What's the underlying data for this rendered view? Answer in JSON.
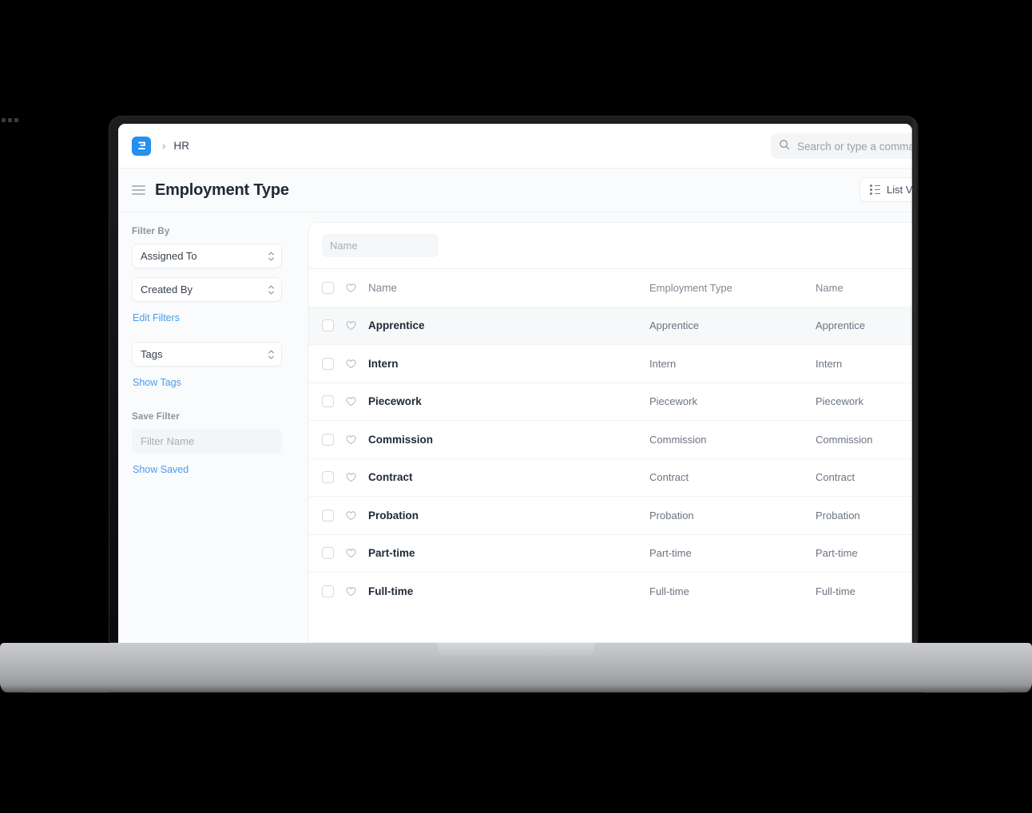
{
  "navbar": {
    "logo_icon": "erpnext-logo-icon",
    "breadcrumb_separator": "›",
    "breadcrumb": "HR",
    "search_icon": "search-icon",
    "search_placeholder": "Search or type a comma",
    "search_value": ""
  },
  "pagehead": {
    "menu_icon": "hamburger-menu-icon",
    "title": "Employment Type",
    "view_switcher_icon": "list-view-icon",
    "view_switcher_label": "List Vie"
  },
  "sidebar": {
    "filter_by_label": "Filter By",
    "filters": [
      {
        "label": "Assigned To",
        "icon": "stepper-chevrons-icon"
      },
      {
        "label": "Created By",
        "icon": "stepper-chevrons-icon"
      }
    ],
    "edit_filters_link": "Edit Filters",
    "tags": {
      "label": "Tags",
      "icon": "stepper-chevrons-icon"
    },
    "show_tags_link": "Show Tags",
    "save_filter_label": "Save Filter",
    "filter_name_placeholder": "Filter Name",
    "filter_name_value": "",
    "show_saved_link": "Show Saved"
  },
  "list": {
    "name_filter_placeholder": "Name",
    "name_filter_value": "",
    "columns": {
      "name": "Name",
      "employment_type": "Employment Type",
      "name2": "Name"
    },
    "rows": [
      {
        "name": "Apprentice",
        "employment_type": "Apprentice",
        "name2": "Apprentice",
        "selected": true
      },
      {
        "name": "Intern",
        "employment_type": "Intern",
        "name2": "Intern",
        "selected": false
      },
      {
        "name": "Piecework",
        "employment_type": "Piecework",
        "name2": "Piecework",
        "selected": false
      },
      {
        "name": "Commission",
        "employment_type": "Commission",
        "name2": "Commission",
        "selected": false
      },
      {
        "name": "Contract",
        "employment_type": "Contract",
        "name2": "Contract",
        "selected": false
      },
      {
        "name": "Probation",
        "employment_type": "Probation",
        "name2": "Probation",
        "selected": false
      },
      {
        "name": "Part-time",
        "employment_type": "Part-time",
        "name2": "Part-time",
        "selected": false
      },
      {
        "name": "Full-time",
        "employment_type": "Full-time",
        "name2": "Full-time",
        "selected": false
      }
    ]
  },
  "colors": {
    "brand_blue": "#2490ef",
    "link_blue": "#4a9bf0",
    "page_bg": "#fafbfc",
    "panel_bg": "#ffffff",
    "selected_row": "#f7f8f9",
    "text_primary": "#1f2937",
    "text_muted": "#6b7481"
  }
}
